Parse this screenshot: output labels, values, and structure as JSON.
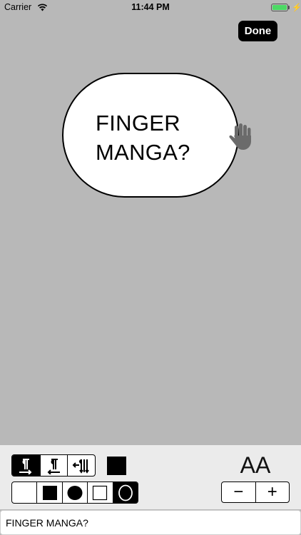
{
  "status_bar": {
    "carrier": "Carrier",
    "time": "11:44 PM",
    "battery_color": "#4cd964"
  },
  "toolbar": {
    "done_label": "Done"
  },
  "canvas": {
    "background": "#b8b8b8",
    "bubble_text": "FINGER MANGA?",
    "drag_icon": "hand-icon"
  },
  "panel": {
    "direction_options": [
      "paragraph-right-icon",
      "paragraph-left-icon",
      "vertical-text-icon"
    ],
    "direction_selected": 0,
    "text_color": "#000000",
    "shape_options": [
      "none",
      "filled-square",
      "filled-circle",
      "outline-square",
      "outline-circle"
    ],
    "shape_selected": 4,
    "font_size_label": "AA",
    "decrease_label": "−",
    "increase_label": "+"
  },
  "text_input": {
    "value": "FINGER MANGA?"
  }
}
